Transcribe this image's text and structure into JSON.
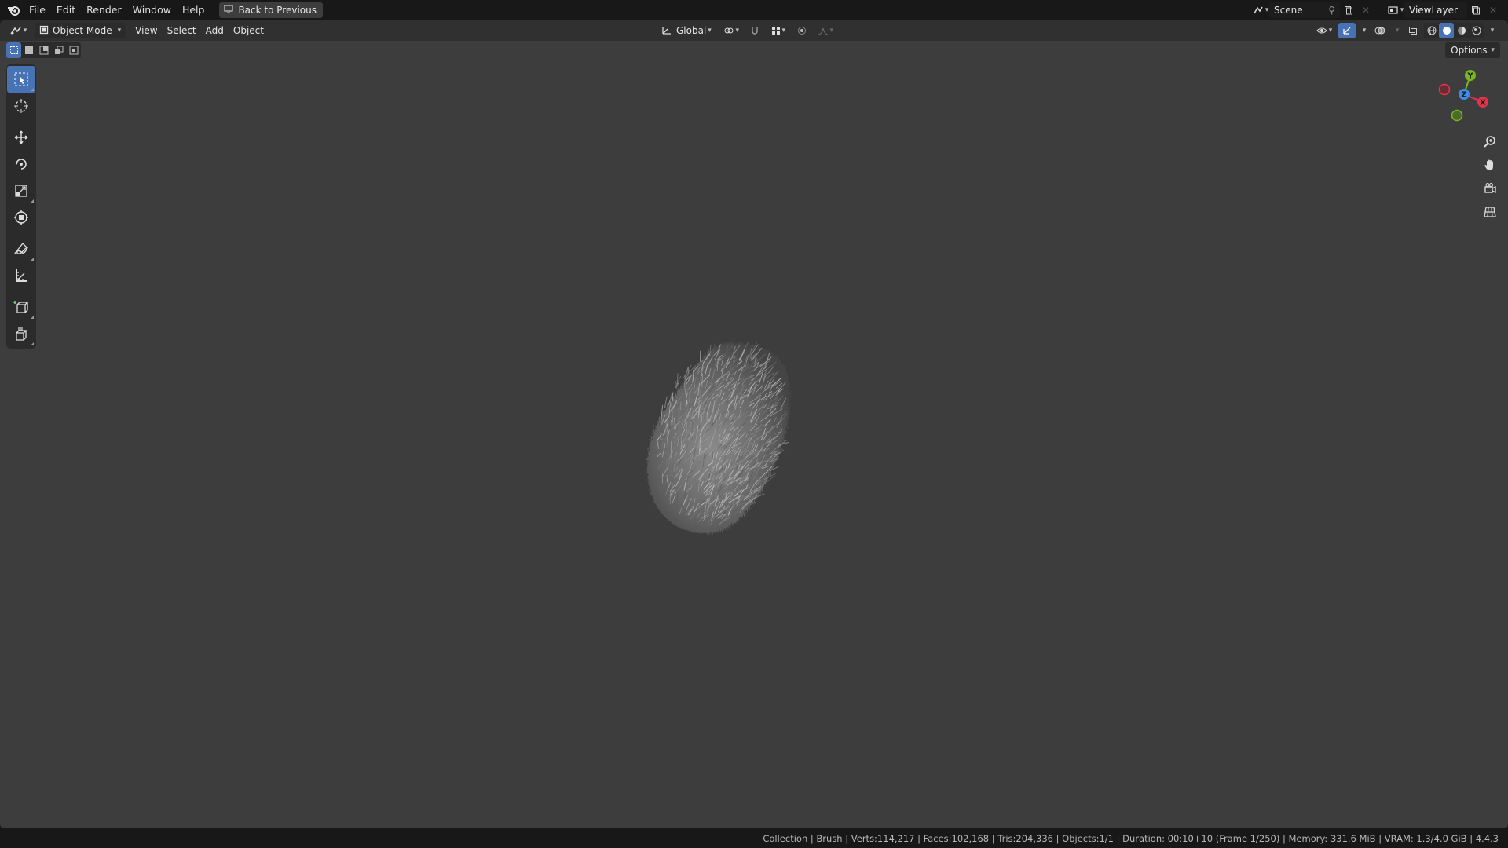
{
  "topbar": {
    "menu": [
      "File",
      "Edit",
      "Render",
      "Window",
      "Help"
    ],
    "back_button": "Back to Previous",
    "scene": "Scene",
    "view_layer": "ViewLayer"
  },
  "header": {
    "mode": "Object Mode",
    "menus": [
      "View",
      "Select",
      "Add",
      "Object"
    ],
    "orientation": "Global"
  },
  "viewport": {
    "options_label": "Options",
    "gizmo_axes": {
      "x": "X",
      "y": "Y",
      "z": "Z"
    }
  },
  "toolbar": {
    "tools": [
      "select-box",
      "cursor",
      "move",
      "rotate",
      "scale",
      "transform",
      "annotate",
      "measure",
      "add-cube",
      "extrude"
    ]
  },
  "statusbar": {
    "text": "Collection | Brush | Verts:114,217 | Faces:102,168 | Tris:204,336 | Objects:1/1 | Duration: 00:10+10 (Frame 1/250) | Memory: 331.6 MiB | VRAM: 1.3/4.0 GiB | 4.4.3"
  },
  "colors": {
    "accent": "#4772b3",
    "axis_x": "#e2334a",
    "axis_y": "#7ab623",
    "axis_z": "#3b8ded"
  }
}
